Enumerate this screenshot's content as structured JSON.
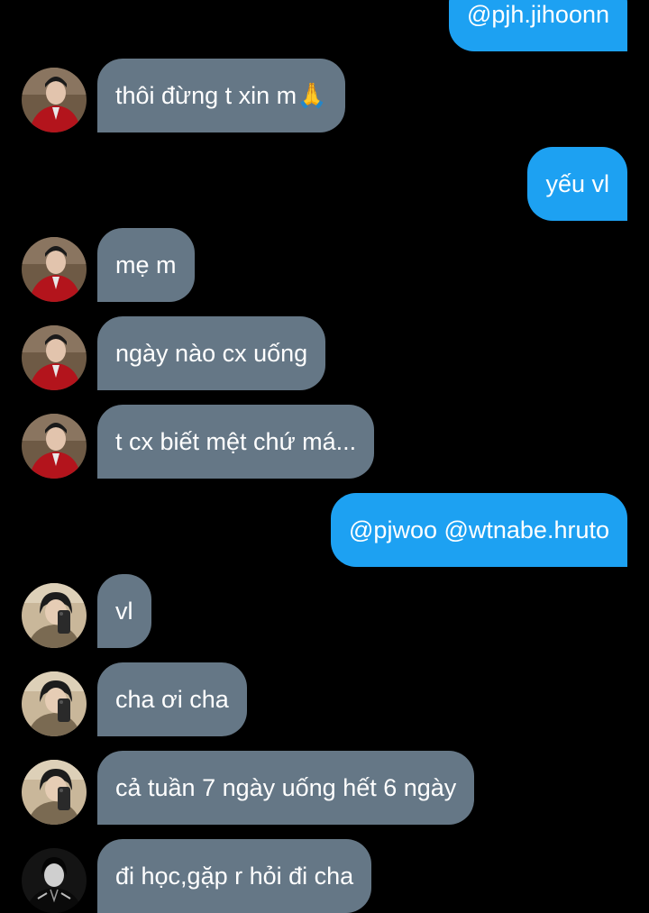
{
  "conversation": {
    "messages": [
      {
        "side": "out",
        "text": "@pjh.jihoonn"
      },
      {
        "side": "in",
        "sender_avatar": "red-shirt-avatar",
        "text": "thôi đừng t xin m🙏"
      },
      {
        "side": "out",
        "text": "yếu vl"
      },
      {
        "side": "in",
        "sender_avatar": "red-shirt-avatar",
        "text": "mẹ m"
      },
      {
        "side": "in",
        "sender_avatar": "red-shirt-avatar",
        "text": "ngày nào cx uống"
      },
      {
        "side": "in",
        "sender_avatar": "red-shirt-avatar",
        "text": "t cx biết mệt chứ má..."
      },
      {
        "side": "out",
        "text": "@pjwoo @wtnabe.hruto"
      },
      {
        "side": "in",
        "sender_avatar": "mirror-selfie-avatar",
        "text": "vl"
      },
      {
        "side": "in",
        "sender_avatar": "mirror-selfie-avatar",
        "text": "cha ơi cha"
      },
      {
        "side": "in",
        "sender_avatar": "mirror-selfie-avatar",
        "text": "cả tuần 7 ngày uống hết 6 ngày"
      },
      {
        "side": "in",
        "sender_avatar": "dark-jacket-avatar",
        "text": "đi học,gặp r hỏi đi cha"
      }
    ]
  },
  "colors": {
    "background": "#000000",
    "incoming_bubble": "#657786",
    "outgoing_bubble": "#1da1f2",
    "bubble_text": "#ffffff"
  }
}
